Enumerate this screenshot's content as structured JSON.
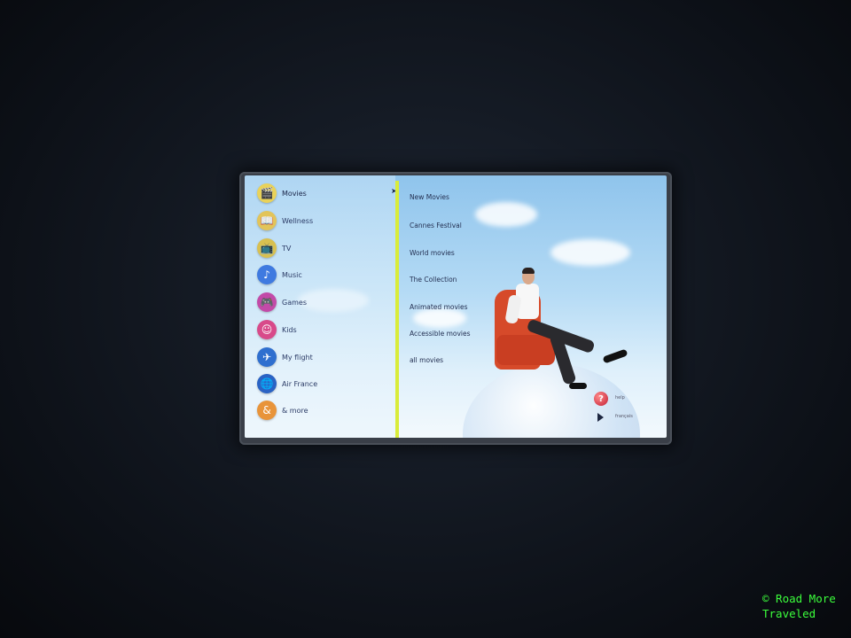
{
  "menu": {
    "items": [
      {
        "label": "Movies",
        "icon": "clapperboard-icon",
        "color": "#e9d25a",
        "glyph": "🎬"
      },
      {
        "label": "Wellness",
        "icon": "book-icon",
        "color": "#e2c45a",
        "glyph": "📖"
      },
      {
        "label": "TV",
        "icon": "tv-icon",
        "color": "#d8c050",
        "glyph": "📺"
      },
      {
        "label": "Music",
        "icon": "music-note-icon",
        "color": "#3f7ae0",
        "glyph": "♪"
      },
      {
        "label": "Games",
        "icon": "gamepad-icon",
        "color": "#c24aa8",
        "glyph": "🎮"
      },
      {
        "label": "Kids",
        "icon": "kids-icon",
        "color": "#d84a8a",
        "glyph": "☺"
      },
      {
        "label": "My flight",
        "icon": "plane-icon",
        "color": "#2f6fcf",
        "glyph": "✈"
      },
      {
        "label": "Air France",
        "icon": "globe-icon",
        "color": "#2a63c4",
        "glyph": "🌐"
      },
      {
        "label": "& more",
        "icon": "ampersand-icon",
        "color": "#e8943a",
        "glyph": "&"
      }
    ],
    "active_index": 0
  },
  "submenu": {
    "items": [
      "New Movies",
      "Cannes Festival",
      "World movies",
      "The Collection",
      "Animated movies",
      "Accessible movies",
      "all movies"
    ]
  },
  "help_label": "help",
  "language_label": "français",
  "watermark": "© Road More Traveled"
}
